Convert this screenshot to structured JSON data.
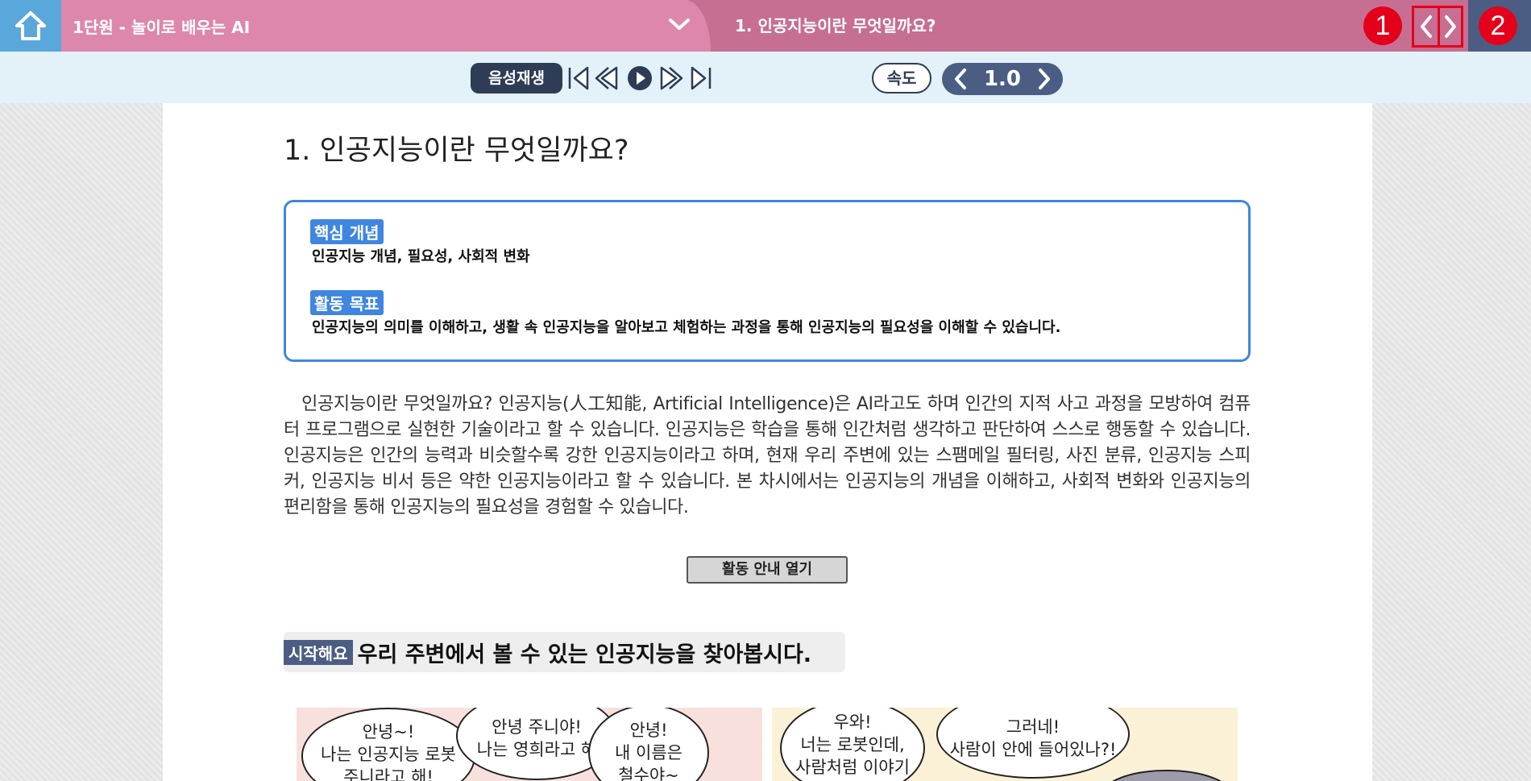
{
  "header": {
    "unit_title": "1단원 - 놀이로 배우는 AI",
    "lesson_title": "1. 인공지능이란 무엇일까요?",
    "badge_1": "1",
    "badge_2": "2"
  },
  "audio": {
    "voice_play_label": "음성재생",
    "speed_label": "속도",
    "speed_value": "1.0"
  },
  "content": {
    "heading": "1. 인공지능이란 무엇일까요?",
    "core_tag": "핵심 개념",
    "core_desc": "인공지능 개념, 필요성, 사회적 변화",
    "goal_tag": "활동 목표",
    "goal_desc": "인공지능의 의미를 이해하고, 생활 속 인공지능을 알아보고 체험하는 과정을 통해 인공지능의 필요성을 이해할 수 있습니다.",
    "intro": "인공지능이란 무엇일까요? 인공지능(人工知能, Artificial Intelligence)은 AI라고도 하며 인간의 지적 사고 과정을 모방하여 컴퓨터 프로그램으로 실현한 기술이라고 할 수 있습니다. 인공지능은 학습을 통해 인간처럼 생각하고 판단하여 스스로 행동할 수 있습니다. 인공지능은 인간의 능력과 비슷할수록 강한 인공지능이라고 하며, 현재 우리 주변에 있는 스팸메일 필터링, 사진 분류, 인공지능 스피커, 인공지능 비서 등은 약한 인공지능이라고 할 수 있습니다. 본 차시에서는 인공지능의 개념을 이해하고, 사회적 변화와 인공지능의 편리함을 통해 인공지능의 필요성을 경험할 수 있습니다.",
    "activity_guide_label": "활동 안내 열기",
    "start_tag": "시작해요",
    "start_title": "우리 주변에서 볼 수 있는 인공지능을 찾아봅시다."
  },
  "comic": {
    "bubble_1": [
      "안녕~!",
      "나는 인공지능 로봇",
      "주니라고 해!"
    ],
    "bubble_2": [
      "안녕 주니야!",
      "나는 영희라고 해"
    ],
    "bubble_3": [
      "안녕!",
      "내 이름은",
      "철수야~"
    ],
    "bubble_4": [
      "우와!",
      "너는 로봇인데,",
      "사람처럼 이야기"
    ],
    "bubble_5": [
      "그러네!",
      "사람이 안에 들어있나?!"
    ]
  },
  "colors": {
    "topbar": "#c66f92",
    "unit_dropdown": "#dd87ac",
    "home": "#5aa7dc",
    "accent_blue": "#3f86e0",
    "navy": "#2e3c56",
    "highlight_red": "#e4001b"
  }
}
